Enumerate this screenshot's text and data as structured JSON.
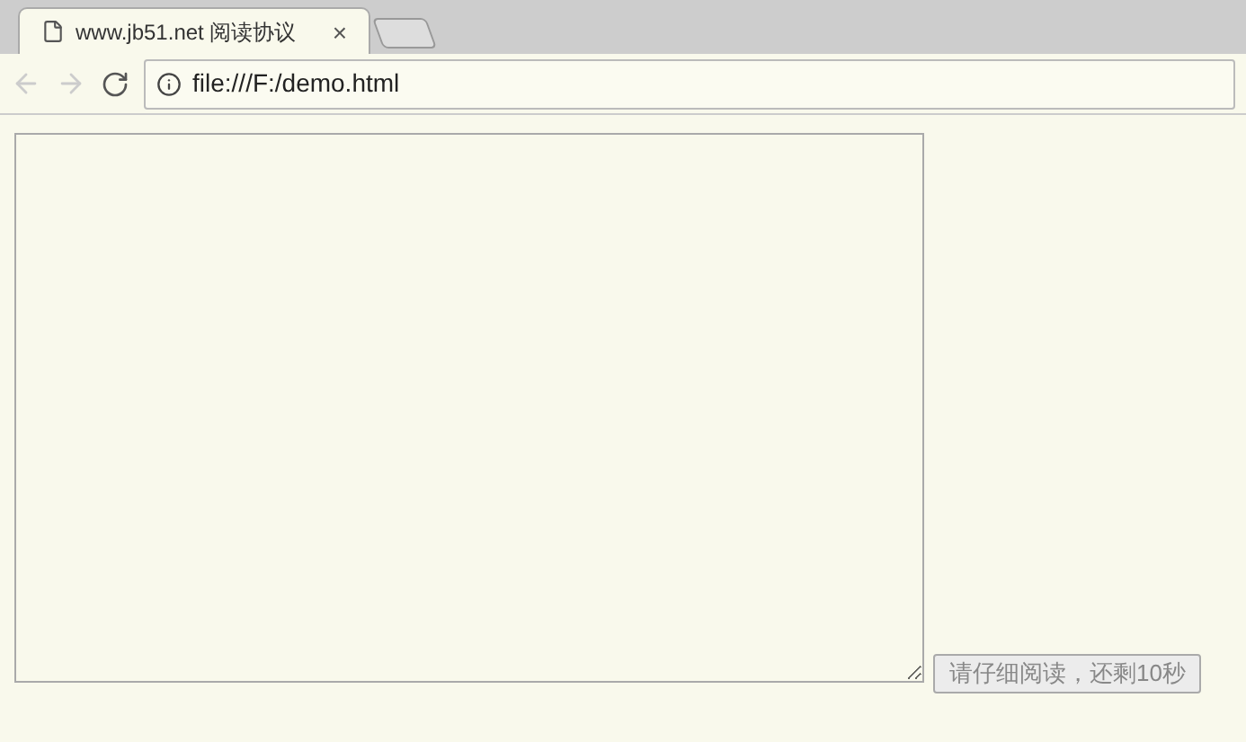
{
  "tab": {
    "title": "www.jb51.net 阅读协议",
    "close": "×"
  },
  "toolbar": {
    "back_disabled": true,
    "forward_disabled": true,
    "url": "file:///F:/demo.html"
  },
  "page": {
    "button": {
      "label": "请仔细阅读，还剩10秒",
      "disabled": true
    }
  }
}
